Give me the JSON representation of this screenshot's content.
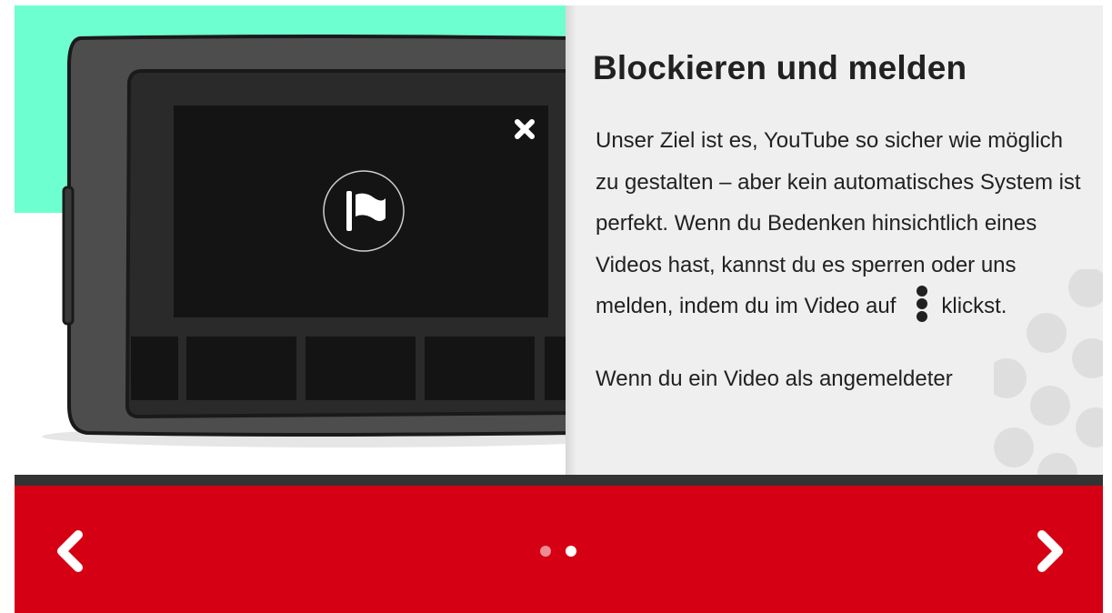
{
  "slide": {
    "heading": "Blockieren und melden",
    "paragraph1_before_icon": "Unser Ziel ist es, YouTube so sicher wie möglich zu gestalten – aber kein automatisches System ist perfekt. Wenn du Bedenken hinsichtlich eines Videos hast, kannst du es sperren oder uns melden, indem du im Video auf",
    "paragraph1_after_icon": "klickst.",
    "paragraph2": "Wenn du ein Video als angemeldeter",
    "inline_icon": "more-vertical-icon"
  },
  "illustration": {
    "icons": [
      "close-icon",
      "flag-icon"
    ],
    "colors": {
      "background": "#6effd0",
      "device": "#4a4a4a",
      "screen": "#111111"
    }
  },
  "nav": {
    "prev_icon": "chevron-left-icon",
    "next_icon": "chevron-right-icon",
    "pages": 2,
    "current_page": 2
  },
  "colors": {
    "navbar": "#d50014",
    "text": "#212121",
    "panel": "#efefef"
  }
}
